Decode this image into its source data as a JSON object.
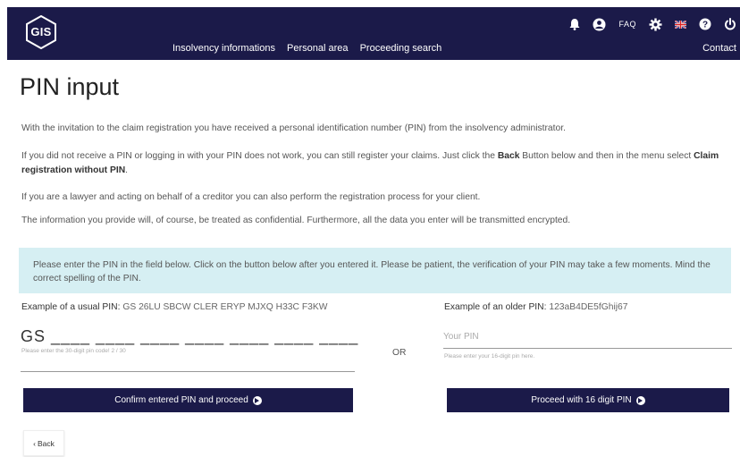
{
  "header": {
    "logo_text": "GIS",
    "nav": [
      "Insolvency informations",
      "Personal area",
      "Proceeding search"
    ],
    "contact": "Contact",
    "faq": "FAQ",
    "icons": [
      "bell-icon",
      "user-icon",
      "faq-link",
      "gear-icon",
      "flag-uk-icon",
      "help-icon",
      "power-icon"
    ],
    "bg_color": "#1b1a49"
  },
  "page": {
    "title": "PIN input",
    "paragraphs": {
      "p1": "With the invitation to the claim registration you have received a personal identification number (PIN) from the insolvency administrator.",
      "p2_pre": "If you did not receive a PIN or logging in with your PIN does not work, you can still register your claims. Just click the ",
      "p2_back": "Back",
      "p2_mid": " Button below and then in the menu select ",
      "p2_claim": "Claim registration without PIN",
      "p2_post": ".",
      "p3": "If you are a lawyer and acting on behalf of a creditor you can also perform the registration process for your client.",
      "p4": "The information you provide will, of course, be treated as confidential. Furthermore, all the data you enter will be transmitted encrypted."
    },
    "info_box": "Please enter the PIN in the field below. Click on the button below after you entered it. Please be patient, the verification of your PIN may take a few moments. Mind the correct spelling of the PIN.",
    "info_box_color": "#d6eff3"
  },
  "pin_usual": {
    "example_label": "Example of a usual PIN:",
    "example_value": "GS 26LU SBCW CLER ERYP MJXQ H33C F3KW",
    "display": "GS ____ ____ ____ ____ ____ ____ ____",
    "hint": "Please enter the 30-digit pin code! 2 / 30"
  },
  "or_label": "OR",
  "pin_old": {
    "example_label": "Example of an older PIN:",
    "example_value": "123aB4DE5fGhij67",
    "placeholder": "Your PIN",
    "hint": "Please enter your 16-digit pin here."
  },
  "buttons": {
    "confirm": "Confirm entered PIN and proceed",
    "proceed16": "Proceed with 16 digit PIN",
    "back": "Back"
  }
}
